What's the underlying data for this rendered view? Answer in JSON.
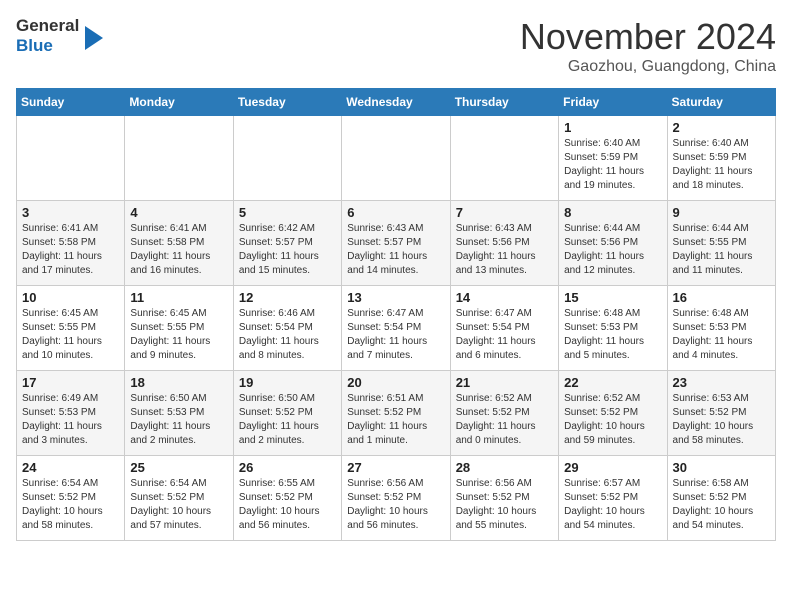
{
  "header": {
    "logo_line1": "General",
    "logo_line2": "Blue",
    "month": "November 2024",
    "location": "Gaozhou, Guangdong, China"
  },
  "weekdays": [
    "Sunday",
    "Monday",
    "Tuesday",
    "Wednesday",
    "Thursday",
    "Friday",
    "Saturday"
  ],
  "weeks": [
    [
      {
        "day": "",
        "info": ""
      },
      {
        "day": "",
        "info": ""
      },
      {
        "day": "",
        "info": ""
      },
      {
        "day": "",
        "info": ""
      },
      {
        "day": "",
        "info": ""
      },
      {
        "day": "1",
        "info": "Sunrise: 6:40 AM\nSunset: 5:59 PM\nDaylight: 11 hours\nand 19 minutes."
      },
      {
        "day": "2",
        "info": "Sunrise: 6:40 AM\nSunset: 5:59 PM\nDaylight: 11 hours\nand 18 minutes."
      }
    ],
    [
      {
        "day": "3",
        "info": "Sunrise: 6:41 AM\nSunset: 5:58 PM\nDaylight: 11 hours\nand 17 minutes."
      },
      {
        "day": "4",
        "info": "Sunrise: 6:41 AM\nSunset: 5:58 PM\nDaylight: 11 hours\nand 16 minutes."
      },
      {
        "day": "5",
        "info": "Sunrise: 6:42 AM\nSunset: 5:57 PM\nDaylight: 11 hours\nand 15 minutes."
      },
      {
        "day": "6",
        "info": "Sunrise: 6:43 AM\nSunset: 5:57 PM\nDaylight: 11 hours\nand 14 minutes."
      },
      {
        "day": "7",
        "info": "Sunrise: 6:43 AM\nSunset: 5:56 PM\nDaylight: 11 hours\nand 13 minutes."
      },
      {
        "day": "8",
        "info": "Sunrise: 6:44 AM\nSunset: 5:56 PM\nDaylight: 11 hours\nand 12 minutes."
      },
      {
        "day": "9",
        "info": "Sunrise: 6:44 AM\nSunset: 5:55 PM\nDaylight: 11 hours\nand 11 minutes."
      }
    ],
    [
      {
        "day": "10",
        "info": "Sunrise: 6:45 AM\nSunset: 5:55 PM\nDaylight: 11 hours\nand 10 minutes."
      },
      {
        "day": "11",
        "info": "Sunrise: 6:45 AM\nSunset: 5:55 PM\nDaylight: 11 hours\nand 9 minutes."
      },
      {
        "day": "12",
        "info": "Sunrise: 6:46 AM\nSunset: 5:54 PM\nDaylight: 11 hours\nand 8 minutes."
      },
      {
        "day": "13",
        "info": "Sunrise: 6:47 AM\nSunset: 5:54 PM\nDaylight: 11 hours\nand 7 minutes."
      },
      {
        "day": "14",
        "info": "Sunrise: 6:47 AM\nSunset: 5:54 PM\nDaylight: 11 hours\nand 6 minutes."
      },
      {
        "day": "15",
        "info": "Sunrise: 6:48 AM\nSunset: 5:53 PM\nDaylight: 11 hours\nand 5 minutes."
      },
      {
        "day": "16",
        "info": "Sunrise: 6:48 AM\nSunset: 5:53 PM\nDaylight: 11 hours\nand 4 minutes."
      }
    ],
    [
      {
        "day": "17",
        "info": "Sunrise: 6:49 AM\nSunset: 5:53 PM\nDaylight: 11 hours\nand 3 minutes."
      },
      {
        "day": "18",
        "info": "Sunrise: 6:50 AM\nSunset: 5:53 PM\nDaylight: 11 hours\nand 2 minutes."
      },
      {
        "day": "19",
        "info": "Sunrise: 6:50 AM\nSunset: 5:52 PM\nDaylight: 11 hours\nand 2 minutes."
      },
      {
        "day": "20",
        "info": "Sunrise: 6:51 AM\nSunset: 5:52 PM\nDaylight: 11 hours\nand 1 minute."
      },
      {
        "day": "21",
        "info": "Sunrise: 6:52 AM\nSunset: 5:52 PM\nDaylight: 11 hours\nand 0 minutes."
      },
      {
        "day": "22",
        "info": "Sunrise: 6:52 AM\nSunset: 5:52 PM\nDaylight: 10 hours\nand 59 minutes."
      },
      {
        "day": "23",
        "info": "Sunrise: 6:53 AM\nSunset: 5:52 PM\nDaylight: 10 hours\nand 58 minutes."
      }
    ],
    [
      {
        "day": "24",
        "info": "Sunrise: 6:54 AM\nSunset: 5:52 PM\nDaylight: 10 hours\nand 58 minutes."
      },
      {
        "day": "25",
        "info": "Sunrise: 6:54 AM\nSunset: 5:52 PM\nDaylight: 10 hours\nand 57 minutes."
      },
      {
        "day": "26",
        "info": "Sunrise: 6:55 AM\nSunset: 5:52 PM\nDaylight: 10 hours\nand 56 minutes."
      },
      {
        "day": "27",
        "info": "Sunrise: 6:56 AM\nSunset: 5:52 PM\nDaylight: 10 hours\nand 56 minutes."
      },
      {
        "day": "28",
        "info": "Sunrise: 6:56 AM\nSunset: 5:52 PM\nDaylight: 10 hours\nand 55 minutes."
      },
      {
        "day": "29",
        "info": "Sunrise: 6:57 AM\nSunset: 5:52 PM\nDaylight: 10 hours\nand 54 minutes."
      },
      {
        "day": "30",
        "info": "Sunrise: 6:58 AM\nSunset: 5:52 PM\nDaylight: 10 hours\nand 54 minutes."
      }
    ]
  ]
}
